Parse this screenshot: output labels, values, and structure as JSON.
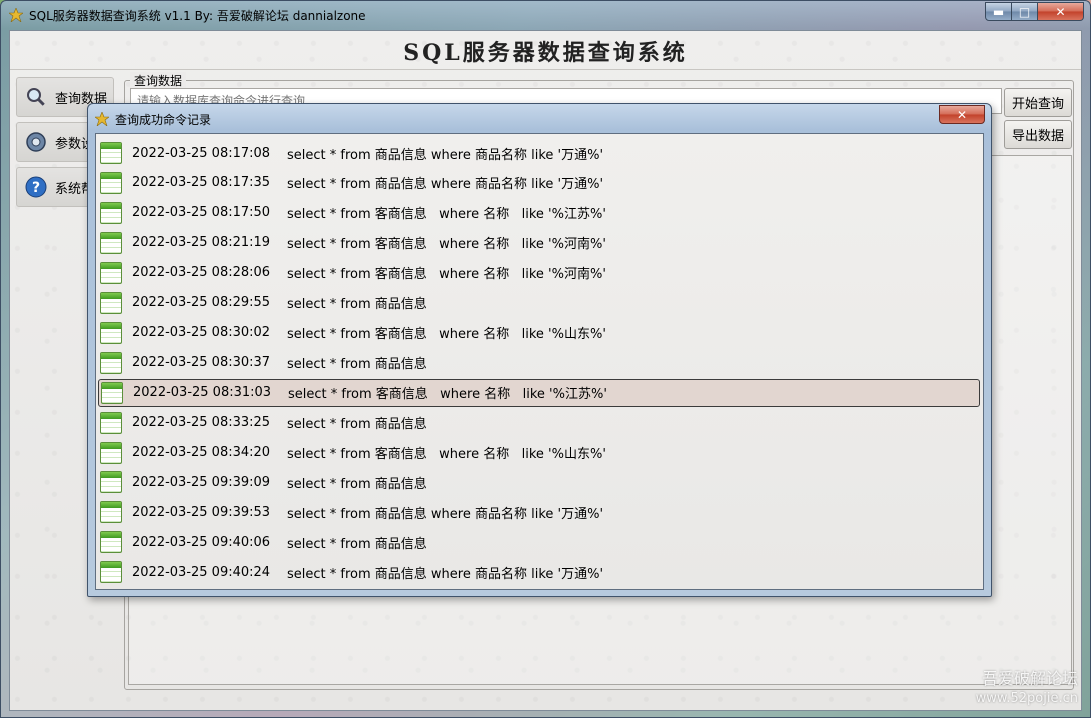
{
  "window": {
    "title": "SQL服务器数据查询系统 v1.1  By: 吾爱破解论坛 dannialzone",
    "minimize_label": "▬",
    "maximize_label": "□",
    "close_label": "✕"
  },
  "header": {
    "title": "SQL服务器数据查询系统"
  },
  "sidebar": {
    "items": [
      {
        "label": "查询数据",
        "icon": "search-icon"
      },
      {
        "label": "参数设",
        "icon": "gear-icon"
      },
      {
        "label": "系统帮",
        "icon": "help-icon"
      }
    ]
  },
  "query_panel": {
    "group_label": "查询数据",
    "input_placeholder": "请输入数据库查询命令进行查询",
    "start_button": "开始查询",
    "export_button": "导出数据"
  },
  "dialog": {
    "title": "查询成功命令记录",
    "close_label": "✕",
    "selected_index": 8,
    "records": [
      {
        "time": "2022-03-25 08:17:08",
        "sql": "select * from 商品信息 where 商品名称 like '万通%'"
      },
      {
        "time": "2022-03-25 08:17:35",
        "sql": "select * from 商品信息 where 商品名称 like '万通%'"
      },
      {
        "time": "2022-03-25 08:17:50",
        "sql": "select * from 客商信息   where 名称   like '%江苏%'"
      },
      {
        "time": "2022-03-25 08:21:19",
        "sql": "select * from 客商信息   where 名称   like '%河南%'"
      },
      {
        "time": "2022-03-25 08:28:06",
        "sql": "select * from 客商信息   where 名称   like '%河南%'"
      },
      {
        "time": "2022-03-25 08:29:55",
        "sql": "select * from 商品信息"
      },
      {
        "time": "2022-03-25 08:30:02",
        "sql": "select * from 客商信息   where 名称   like '%山东%'"
      },
      {
        "time": "2022-03-25 08:30:37",
        "sql": "select * from 商品信息"
      },
      {
        "time": "2022-03-25 08:31:03",
        "sql": "select * from 客商信息   where 名称   like '%江苏%'"
      },
      {
        "time": "2022-03-25 08:33:25",
        "sql": "select * from 商品信息"
      },
      {
        "time": "2022-03-25 08:34:20",
        "sql": "select * from 客商信息   where 名称   like '%山东%'"
      },
      {
        "time": "2022-03-25 09:39:09",
        "sql": "select * from 商品信息"
      },
      {
        "time": "2022-03-25 09:39:53",
        "sql": "select * from 商品信息 where 商品名称 like '万通%'"
      },
      {
        "time": "2022-03-25 09:40:06",
        "sql": "select * from 商品信息"
      },
      {
        "time": "2022-03-25 09:40:24",
        "sql": "select * from 商品信息 where 商品名称 like '万通%'"
      }
    ]
  },
  "watermark": {
    "line1": "吾爱破解论坛",
    "line2": "www.52pojie.cn"
  }
}
